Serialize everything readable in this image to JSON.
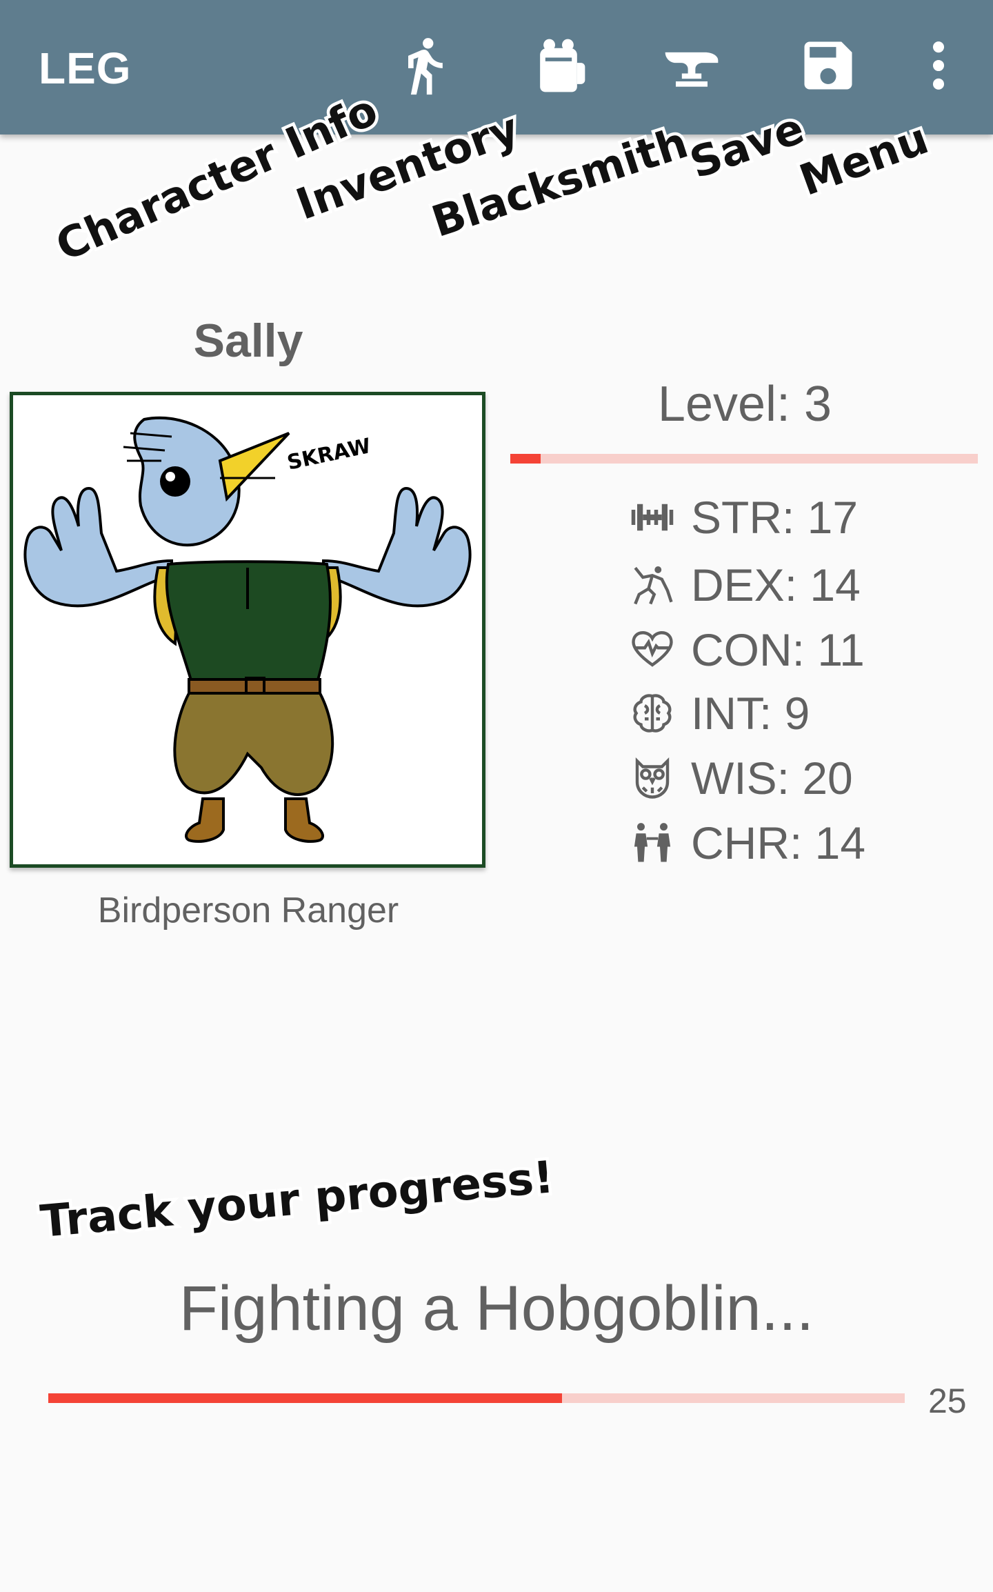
{
  "app": {
    "title": "LEG"
  },
  "actions": [
    {
      "icon": "walking-person-icon",
      "label": "Character Info"
    },
    {
      "icon": "backpack-icon",
      "label": "Inventory"
    },
    {
      "icon": "anvil-icon",
      "label": "Blacksmith"
    },
    {
      "icon": "save-disk-icon",
      "label": "Save"
    },
    {
      "icon": "more-vert-icon",
      "label": "Menu"
    }
  ],
  "annotations": {
    "character_info": "Character Info",
    "inventory": "Inventory",
    "blacksmith": "Blacksmith",
    "save": "Save",
    "menu": "Menu",
    "tagline": "Track your progress!"
  },
  "character": {
    "name": "Sally",
    "class": "Birdperson Ranger",
    "portrait_caption": "SKRAW",
    "level_label": "Level: 3",
    "level_progress": 0.065
  },
  "stats": [
    {
      "icon": "dumbbell-icon",
      "text": "STR: 17"
    },
    {
      "icon": "acrobat-icon",
      "text": "DEX: 14"
    },
    {
      "icon": "heartbeat-icon",
      "text": "CON: 11"
    },
    {
      "icon": "brain-icon",
      "text": "INT: 9"
    },
    {
      "icon": "owl-icon",
      "text": "WIS: 20"
    },
    {
      "icon": "people-icon",
      "text": "CHR: 14"
    }
  ],
  "quest": {
    "text": "Fighting a Hobgoblin...",
    "progress": 0.6,
    "count": "25"
  },
  "colors": {
    "appbar": "#5f7d8e",
    "accent": "#f44336",
    "track": "#f8cfcb",
    "text": "#616161",
    "portrait_border": "#1c4b24"
  }
}
